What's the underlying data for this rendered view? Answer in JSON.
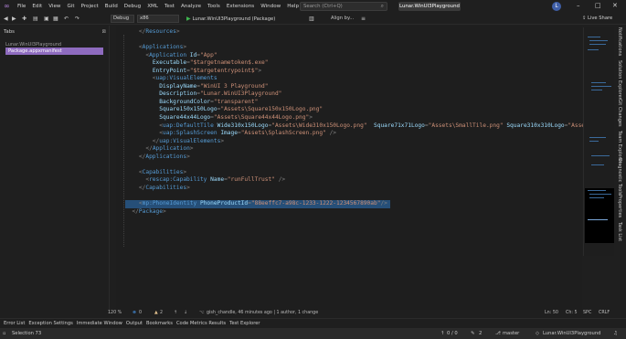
{
  "menu": {
    "items": [
      "File",
      "Edit",
      "View",
      "Git",
      "Project",
      "Build",
      "Debug",
      "XML",
      "Test",
      "Analyze",
      "Tools",
      "Extensions",
      "Window",
      "Help"
    ],
    "search_placeholder": "Search (Ctrl+Q)",
    "project_name": "Lunar.WinUI3Playground",
    "avatar": "L"
  },
  "toolbar": {
    "configuration": "Debug",
    "platform": "x86",
    "run_target": "Lunar.WinUI3Playground (Package)",
    "align_label": "Align by...",
    "live_share": "Live Share"
  },
  "tabs_panel": {
    "title": "Tabs",
    "group": "Lunar.WinUI3Playground",
    "active_tab": "Package.appxmanifest"
  },
  "code_lines": [
    [
      [
        "t-punc",
        "    </"
      ],
      [
        "t-tag",
        "Resources"
      ],
      [
        "t-punc",
        ">"
      ]
    ],
    [
      [
        "t-text",
        ""
      ]
    ],
    [
      [
        "t-punc",
        "    <"
      ],
      [
        "t-tag",
        "Applications"
      ],
      [
        "t-punc",
        ">"
      ]
    ],
    [
      [
        "t-punc",
        "      <"
      ],
      [
        "t-tag",
        "Application"
      ],
      [
        "t-text",
        " "
      ],
      [
        "t-attr",
        "Id"
      ],
      [
        "t-punc",
        "="
      ],
      [
        "t-val",
        "\"App\""
      ]
    ],
    [
      [
        "t-text",
        "        "
      ],
      [
        "t-attr",
        "Executable"
      ],
      [
        "t-punc",
        "="
      ],
      [
        "t-val",
        "\"$targetnametoken$.exe\""
      ]
    ],
    [
      [
        "t-text",
        "        "
      ],
      [
        "t-attr",
        "EntryPoint"
      ],
      [
        "t-punc",
        "="
      ],
      [
        "t-val",
        "\"$targetentrypoint$\""
      ],
      [
        "t-punc",
        ">"
      ]
    ],
    [
      [
        "t-punc",
        "        <"
      ],
      [
        "t-tag",
        "uap:VisualElements"
      ]
    ],
    [
      [
        "t-text",
        "          "
      ],
      [
        "t-attr",
        "DisplayName"
      ],
      [
        "t-punc",
        "="
      ],
      [
        "t-val",
        "\"WinUI 3 Playground\""
      ]
    ],
    [
      [
        "t-text",
        "          "
      ],
      [
        "t-attr",
        "Description"
      ],
      [
        "t-punc",
        "="
      ],
      [
        "t-val",
        "\"Lunar.WinUI3Playground\""
      ]
    ],
    [
      [
        "t-text",
        "          "
      ],
      [
        "t-attr",
        "BackgroundColor"
      ],
      [
        "t-punc",
        "="
      ],
      [
        "t-val",
        "\"transparent\""
      ]
    ],
    [
      [
        "t-text",
        "          "
      ],
      [
        "t-attr",
        "Square150x150Logo"
      ],
      [
        "t-punc",
        "="
      ],
      [
        "t-val",
        "\"Assets\\Square150x150Logo.png\""
      ]
    ],
    [
      [
        "t-text",
        "          "
      ],
      [
        "t-attr",
        "Square44x44Logo"
      ],
      [
        "t-punc",
        "="
      ],
      [
        "t-val",
        "\"Assets\\Square44x44Logo.png\""
      ],
      [
        "t-punc",
        ">"
      ]
    ],
    [
      [
        "t-punc",
        "          <"
      ],
      [
        "t-tag",
        "uap:DefaultTile"
      ],
      [
        "t-text",
        " "
      ],
      [
        "t-attr",
        "Wide310x150Logo"
      ],
      [
        "t-punc",
        "="
      ],
      [
        "t-val",
        "\"Assets\\Wide310x150Logo.png\""
      ],
      [
        "t-text",
        "  "
      ],
      [
        "t-attr",
        "Square71x71Logo"
      ],
      [
        "t-punc",
        "="
      ],
      [
        "t-val",
        "\"Assets\\SmallTile.png\""
      ],
      [
        "t-text",
        " "
      ],
      [
        "t-attr",
        "Square310x310Logo"
      ],
      [
        "t-punc",
        "="
      ],
      [
        "t-val",
        "\"Assets\\LargeTile.png\""
      ],
      [
        "t-punc",
        "/>"
      ]
    ],
    [
      [
        "t-punc",
        "          <"
      ],
      [
        "t-tag",
        "uap:SplashScreen"
      ],
      [
        "t-text",
        " "
      ],
      [
        "t-attr",
        "Image"
      ],
      [
        "t-punc",
        "="
      ],
      [
        "t-val",
        "\"Assets\\SplashScreen.png\""
      ],
      [
        "t-text",
        " "
      ],
      [
        "t-punc",
        "/>"
      ]
    ],
    [
      [
        "t-punc",
        "        </"
      ],
      [
        "t-tag",
        "uap:VisualElements"
      ],
      [
        "t-punc",
        ">"
      ]
    ],
    [
      [
        "t-punc",
        "      </"
      ],
      [
        "t-tag",
        "Application"
      ],
      [
        "t-punc",
        ">"
      ]
    ],
    [
      [
        "t-punc",
        "    </"
      ],
      [
        "t-tag",
        "Applications"
      ],
      [
        "t-punc",
        ">"
      ]
    ],
    [
      [
        "t-text",
        ""
      ]
    ],
    [
      [
        "t-punc",
        "    <"
      ],
      [
        "t-tag",
        "Capabilities"
      ],
      [
        "t-punc",
        ">"
      ]
    ],
    [
      [
        "t-punc",
        "      <"
      ],
      [
        "t-tag",
        "rescap:Capability"
      ],
      [
        "t-text",
        " "
      ],
      [
        "t-attr",
        "Name"
      ],
      [
        "t-punc",
        "="
      ],
      [
        "t-val",
        "\"runFullTrust\""
      ],
      [
        "t-text",
        " "
      ],
      [
        "t-punc",
        "/>"
      ]
    ],
    [
      [
        "t-punc",
        "    </"
      ],
      [
        "t-tag",
        "Capabilities"
      ],
      [
        "t-punc",
        ">"
      ]
    ],
    [
      [
        "t-text",
        ""
      ]
    ],
    [
      [
        "t-punc",
        "    <"
      ],
      [
        "t-tag",
        "mp:PhoneIdentity"
      ],
      [
        "t-text",
        " "
      ],
      [
        "t-attr",
        "PhoneProductId"
      ],
      [
        "t-punc",
        "="
      ],
      [
        "t-val",
        "\"88eeffc7-a98c-1233-1222-1234567890ab\""
      ],
      [
        "t-punc",
        "/>"
      ]
    ],
    [
      [
        "t-punc",
        "  </"
      ],
      [
        "t-tag",
        "Package"
      ],
      [
        "t-punc",
        ">"
      ]
    ]
  ],
  "selected_line_index": 22,
  "editor_status": {
    "zoom": "120 %",
    "errors": "0",
    "warnings": "2",
    "git_blame": "gish_chandle, 46 minutes ago | 1 author, 1 change",
    "line": "Ln: 50",
    "col": "Ch: 5",
    "spacing": "SPC",
    "eol": "CRLF"
  },
  "right_tabs": [
    "Notifications",
    "Solution Explorer",
    "Git Changes",
    "Team Explorer",
    "Diagnostic Tools",
    "Properties",
    "Task List"
  ],
  "bottom_tabs": [
    "Error List",
    "Exception Settings",
    "Immediate Window",
    "Output",
    "Bookmarks",
    "Code Metrics Results",
    "Test Explorer"
  ],
  "statusbar": {
    "selection": "Selection 73",
    "git_counts": "0 / 0",
    "pencil_count": "2",
    "branch": "master",
    "repo": "Lunar.WinUI3Playground"
  }
}
